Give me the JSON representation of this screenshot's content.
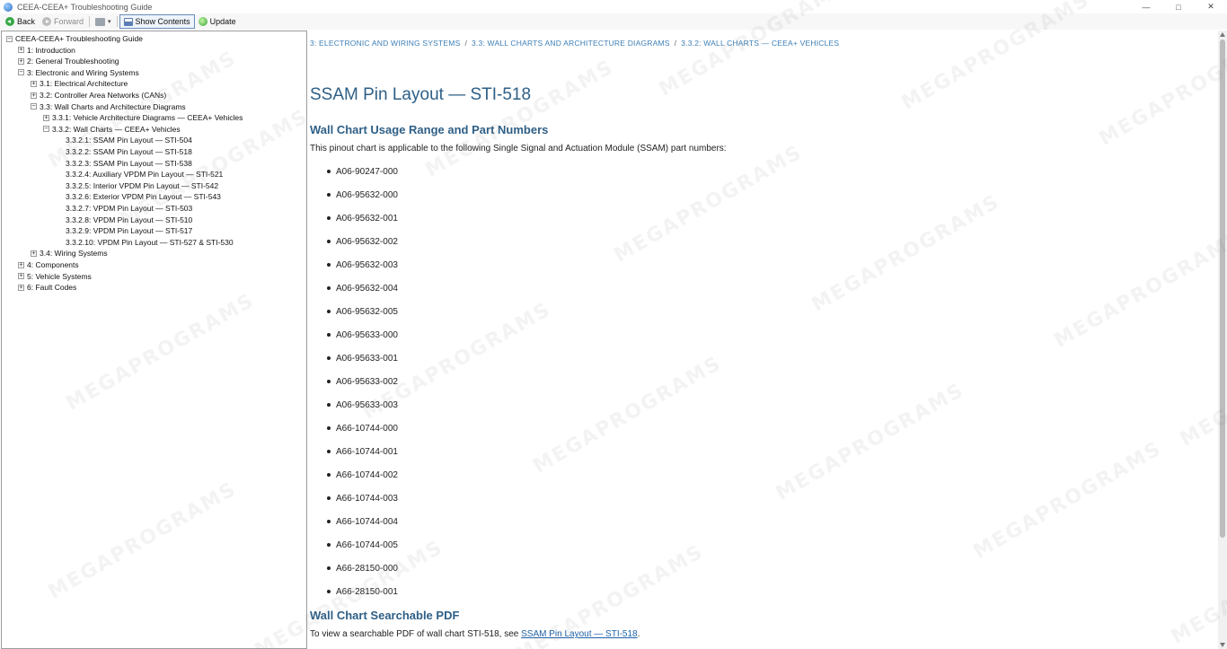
{
  "window": {
    "title": "CEEA-CEEA+ Troubleshooting Guide",
    "minimize_glyph": "—",
    "maximize_glyph": "□",
    "close_glyph": "✕"
  },
  "toolbar": {
    "back_label": "Back",
    "forward_label": "Forward",
    "show_contents_label": "Show Contents",
    "update_label": "Update",
    "print_caret": "▾"
  },
  "tree": {
    "root": "CEEA-CEEA+ Troubleshooting Guide",
    "items": [
      {
        "label": "1: Introduction",
        "expander": "+"
      },
      {
        "label": "2: General Troubleshooting",
        "expander": "+"
      },
      {
        "label": "3: Electronic and Wiring Systems",
        "expander": "−"
      },
      {
        "label": "3.1: Electrical Architecture",
        "expander": "+"
      },
      {
        "label": "3.2: Controller Area Networks (CANs)",
        "expander": "+"
      },
      {
        "label": "3.3: Wall Charts and Architecture Diagrams",
        "expander": "−"
      },
      {
        "label": "3.3.1: Vehicle Architecture Diagrams — CEEA+ Vehicles",
        "expander": "+"
      },
      {
        "label": "3.3.2: Wall Charts — CEEA+ Vehicles",
        "expander": "−"
      },
      {
        "label": "3.3.2.1: SSAM Pin Layout — STI-504"
      },
      {
        "label": "3.3.2.2: SSAM Pin Layout — STI-518"
      },
      {
        "label": "3.3.2.3: SSAM Pin Layout — STI-538"
      },
      {
        "label": "3.3.2.4: Auxiliary VPDM Pin Layout — STI-521"
      },
      {
        "label": "3.3.2.5: Interior VPDM Pin Layout — STI-542"
      },
      {
        "label": "3.3.2.6: Exterior VPDM Pin Layout — STI-543"
      },
      {
        "label": "3.3.2.7: VPDM Pin Layout — STI-503"
      },
      {
        "label": "3.3.2.8: VPDM Pin Layout — STI-510"
      },
      {
        "label": "3.3.2.9: VPDM Pin Layout — STI-517"
      },
      {
        "label": "3.3.2.10: VPDM Pin Layout — STI-527 & STI-530"
      },
      {
        "label": "3.4: Wiring Systems",
        "expander": "+"
      },
      {
        "label": "4: Components",
        "expander": "+"
      },
      {
        "label": "5: Vehicle Systems",
        "expander": "+"
      },
      {
        "label": "6: Fault Codes",
        "expander": "+"
      }
    ]
  },
  "breadcrumb": {
    "items": [
      "3: ELECTRONIC AND WIRING SYSTEMS",
      "3.3: WALL CHARTS AND ARCHITECTURE DIAGRAMS",
      "3.3.2: WALL CHARTS — CEEA+ VEHICLES"
    ],
    "separator": "/"
  },
  "main": {
    "title": "SSAM Pin Layout — STI-518",
    "usage_heading": "Wall Chart Usage Range and Part Numbers",
    "usage_text": "This pinout chart is applicable to the following Single Signal and Actuation Module (SSAM) part numbers:",
    "part_numbers": [
      "A06-90247-000",
      "A06-95632-000",
      "A06-95632-001",
      "A06-95632-002",
      "A06-95632-003",
      "A06-95632-004",
      "A06-95632-005",
      "A06-95633-000",
      "A06-95633-001",
      "A06-95633-002",
      "A06-95633-003",
      "A66-10744-000",
      "A66-10744-001",
      "A66-10744-002",
      "A66-10744-003",
      "A66-10744-004",
      "A66-10744-005",
      "A66-28150-000",
      "A66-28150-001"
    ],
    "pdf_heading": "Wall Chart Searchable PDF",
    "pdf_text_before": "To view a searchable PDF of wall chart STI-518, see ",
    "pdf_link": "SSAM Pin Layout — STI-518",
    "pdf_text_after": "."
  },
  "watermark": {
    "text": "MEGAPROGRAMS"
  },
  "colors": {
    "link": "#1f62a8",
    "heading": "#2e5f86",
    "breadcrumb": "#3d7fb6"
  }
}
